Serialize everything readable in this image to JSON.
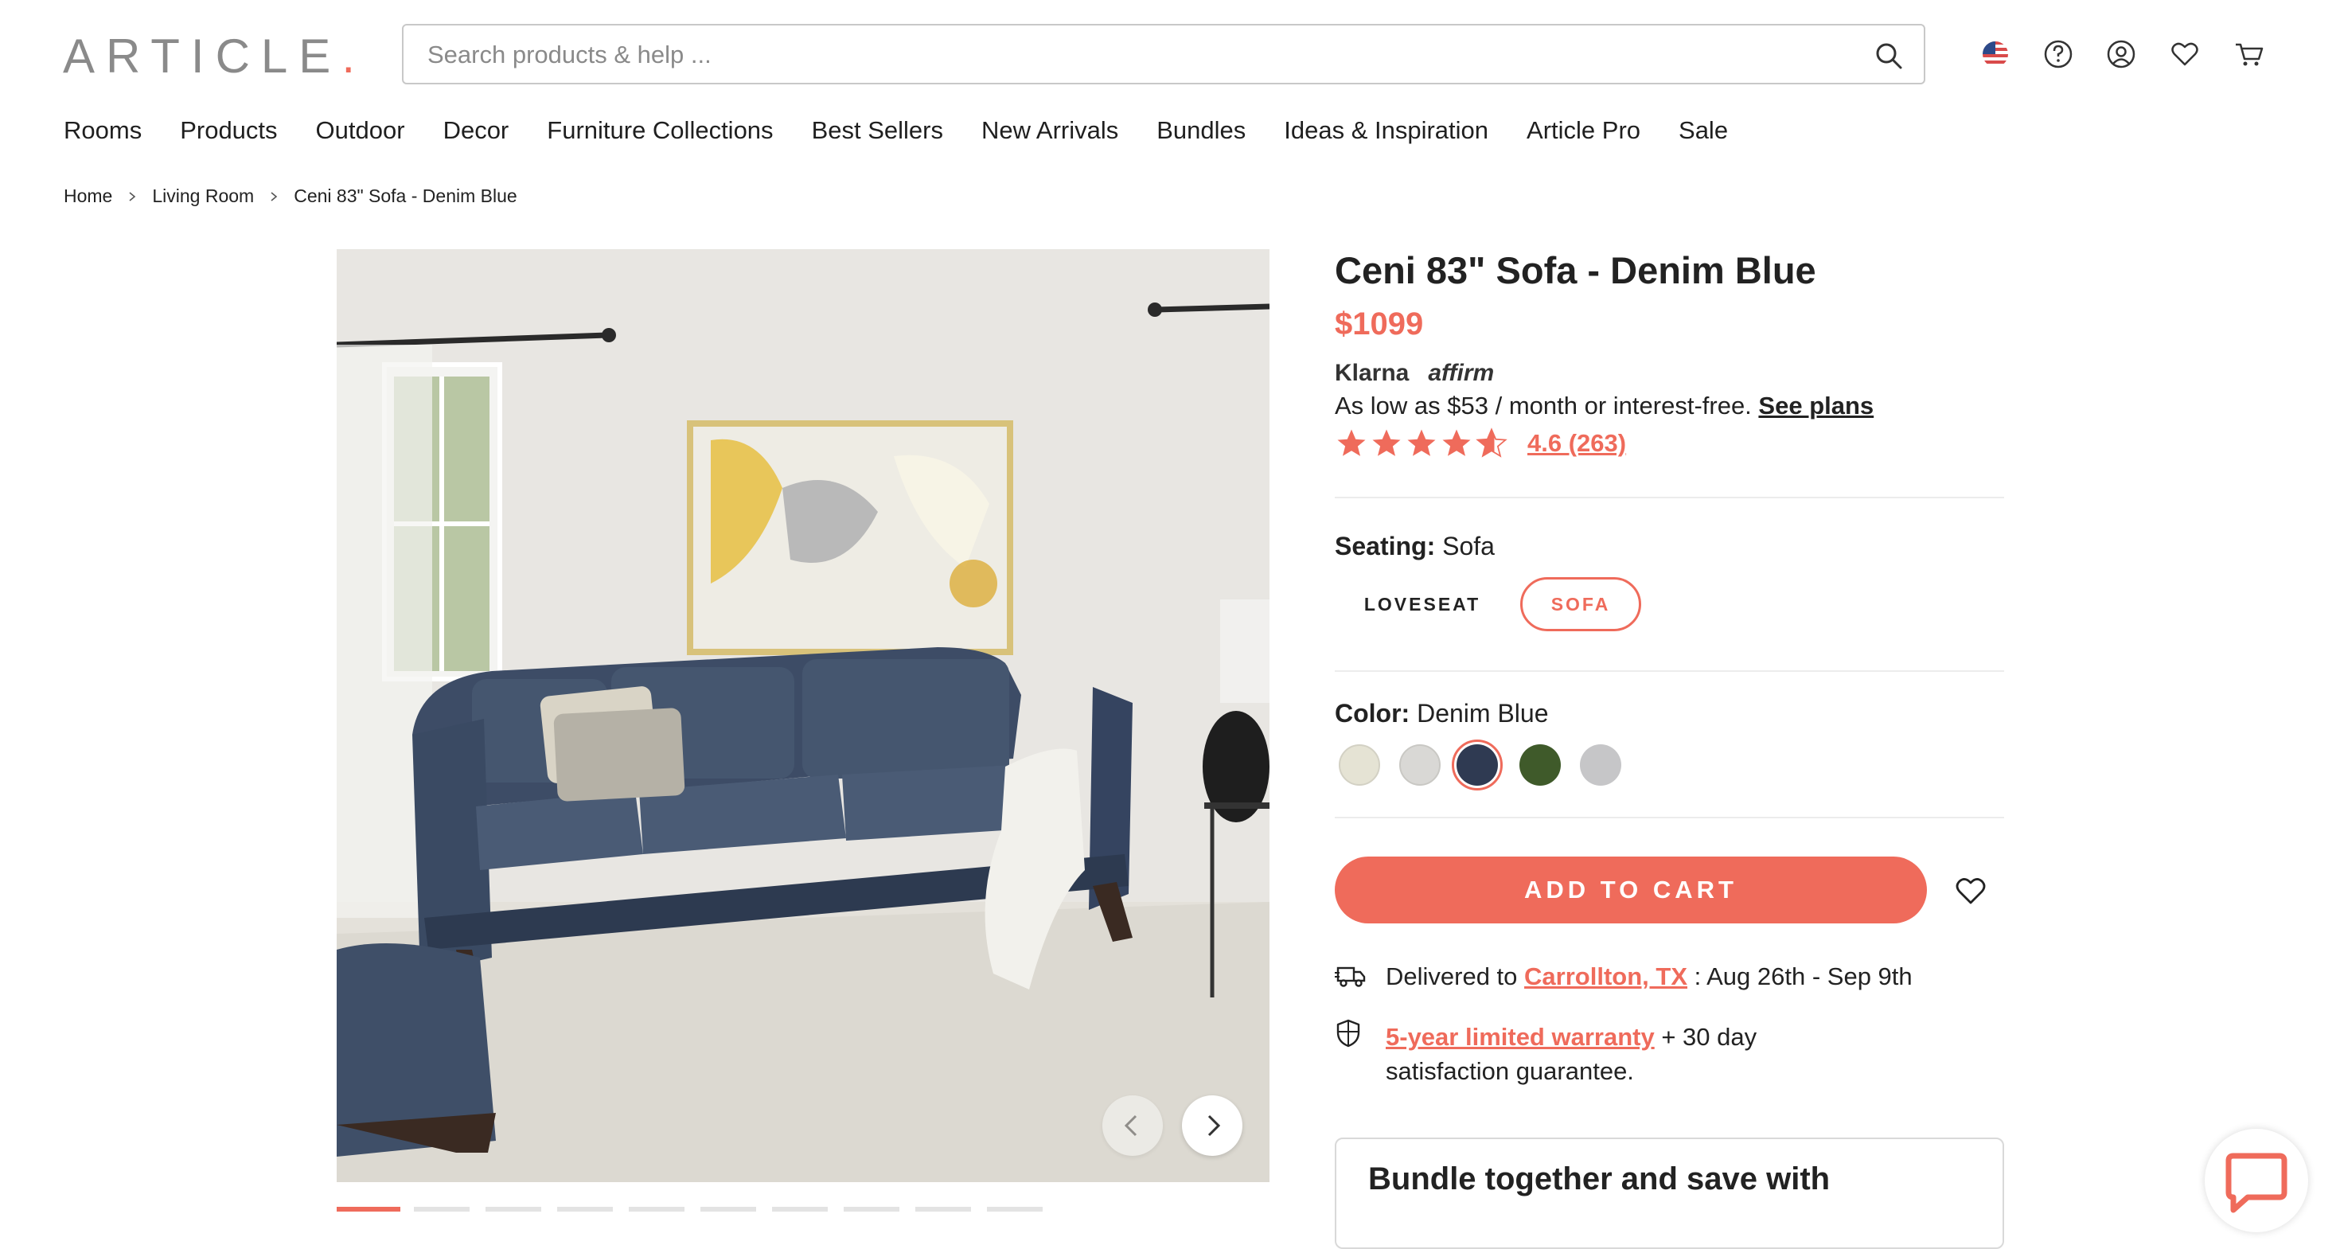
{
  "header": {
    "logo_text": "ARTICLE",
    "logo_dot": ".",
    "search_placeholder": "Search products & help ...",
    "icons": [
      "us-flag-icon",
      "help-icon",
      "account-icon",
      "wishlist-icon",
      "cart-icon"
    ]
  },
  "nav": [
    "Rooms",
    "Products",
    "Outdoor",
    "Decor",
    "Furniture Collections",
    "Best Sellers",
    "New Arrivals",
    "Bundles",
    "Ideas & Inspiration",
    "Article Pro",
    "Sale"
  ],
  "breadcrumb": [
    "Home",
    "Living Room",
    "Ceni 83\" Sofa - Denim Blue"
  ],
  "product": {
    "title": "Ceni 83\" Sofa - Denim Blue",
    "price": "$1099",
    "pay_providers": [
      "Klarna",
      "affirm"
    ],
    "finance_text": "As low as $53 / month or interest-free.",
    "finance_link": "See plans",
    "rating_value": 4.6,
    "rating_text": "4.6 (263)",
    "seating_label": "Seating:",
    "seating_value": "Sofa",
    "seating_options": [
      "LOVESEAT",
      "SOFA"
    ],
    "seating_selected": "SOFA",
    "color_label": "Color:",
    "color_value": "Denim Blue",
    "color_swatches": [
      "#e5e3d4",
      "#d9d8d5",
      "#2f3a52",
      "#3f5a2a",
      "#c6c6c8"
    ],
    "color_selected_index": 2,
    "add_to_cart": "ADD TO CART",
    "delivery_prefix": "Delivered to",
    "delivery_location": "Carrollton, TX",
    "delivery_dates": " : Aug 26th - Sep 9th",
    "warranty_link": "5-year limited warranty",
    "warranty_rest": " + 30 day",
    "warranty_line2": "satisfaction guarantee.",
    "bundle_title": "Bundle together and save with"
  },
  "colors": {
    "accent": "#ef6b5b",
    "text": "#222222",
    "border": "#c8c8c8"
  }
}
